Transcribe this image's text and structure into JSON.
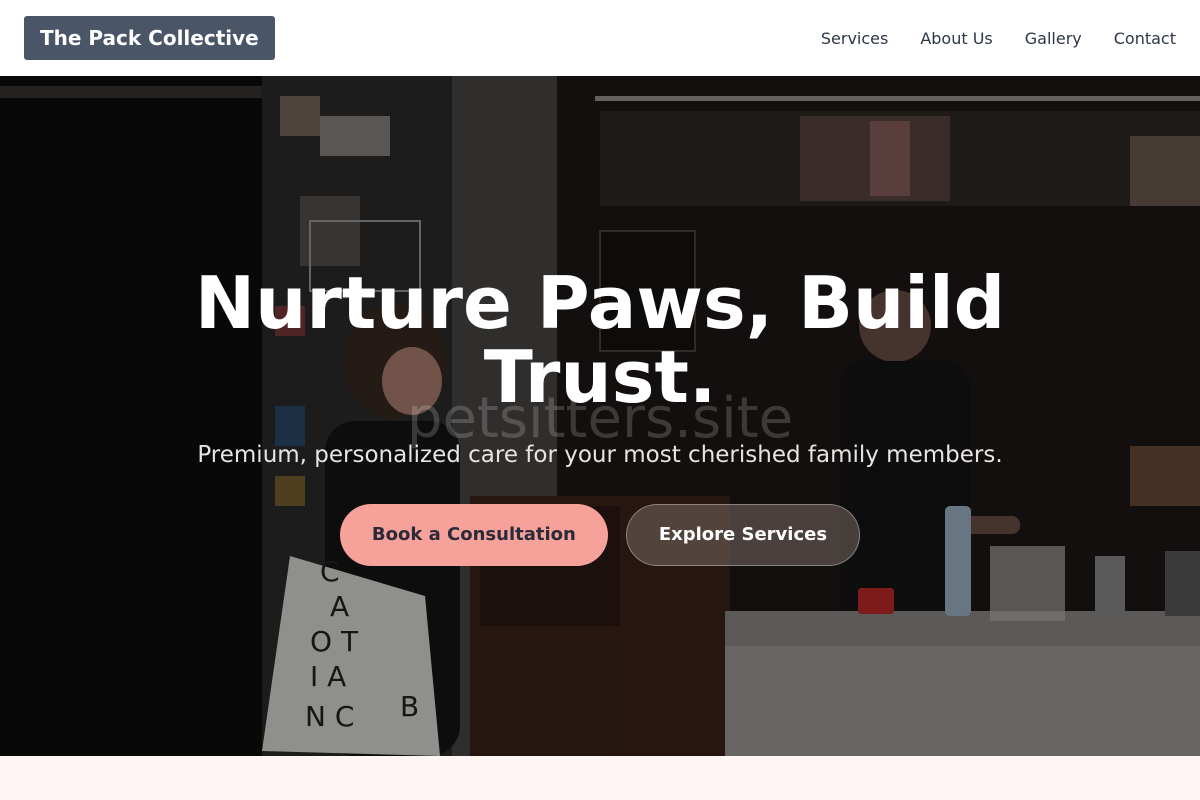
{
  "navbar": {
    "logo": "The Pack Collective",
    "links": [
      "Services",
      "About Us",
      "Gallery",
      "Contact"
    ]
  },
  "hero": {
    "title": "Nurture Paws, Build Trust.",
    "subtitle": "Premium, personalized care for your most cherished family members.",
    "primary_button": "Book a Consultation",
    "secondary_button": "Explore Services",
    "watermark": "petsitters.site"
  },
  "colors": {
    "logo_bg": "#4a5568",
    "primary_button": "#f6a19a",
    "page_bg": "#fff5f4"
  }
}
